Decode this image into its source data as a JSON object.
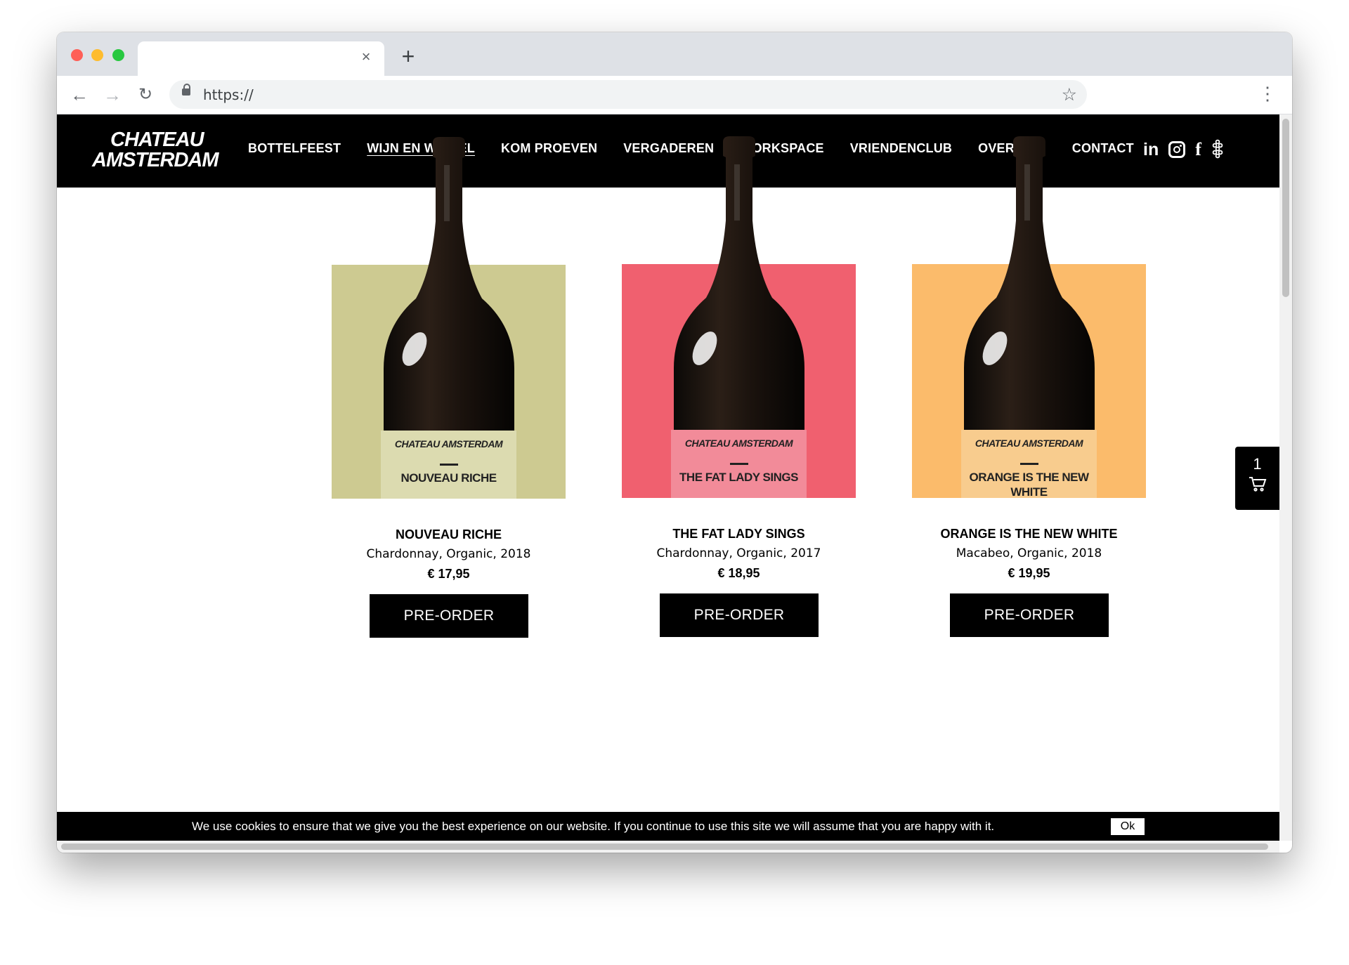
{
  "browser": {
    "url": "https://",
    "tab_close": "×",
    "new_tab": "+"
  },
  "site": {
    "logo": {
      "line1": "CHATEAU",
      "line2": "AMSTERDAM"
    },
    "nav": [
      {
        "label": "BOTTELFEEST",
        "active": false
      },
      {
        "label": "WIJN EN WINKEL",
        "active": true
      },
      {
        "label": "KOM PROEVEN",
        "active": false
      },
      {
        "label": "VERGADEREN",
        "active": false
      },
      {
        "label": "WORKSPACE",
        "active": false
      },
      {
        "label": "VRIENDENCLUB",
        "active": false
      },
      {
        "label": "OVER ONS",
        "active": false
      },
      {
        "label": "CONTACT",
        "active": false
      }
    ],
    "social": [
      "linkedin-icon",
      "instagram-icon",
      "facebook-icon",
      "grapes-icon"
    ]
  },
  "products": [
    {
      "name": "NOUVEAU RICHE",
      "desc": "Chardonnay, Organic, 2018",
      "price": "€ 17,95",
      "button": "PRE-ORDER",
      "bg_color": "#cdca91",
      "label_color": "#dcdbb0",
      "label_brand": "CHATEAU AMSTERDAM",
      "label_name": "NOUVEAU RICHE"
    },
    {
      "name": "THE FAT LADY SINGS",
      "desc": "Chardonnay, Organic, 2017",
      "price": "€ 18,95",
      "button": "PRE-ORDER",
      "bg_color": "#f0606f",
      "label_color": "#f28b99",
      "label_brand": "CHATEAU AMSTERDAM",
      "label_name": "THE FAT LADY SINGS"
    },
    {
      "name": "ORANGE IS THE NEW WHITE",
      "desc": "Macabeo, Organic, 2018",
      "price": "€ 19,95",
      "button": "PRE-ORDER",
      "bg_color": "#fbbb6b",
      "label_color": "#f8cc8e",
      "label_brand": "CHATEAU AMSTERDAM",
      "label_name": "ORANGE IS THE NEW WHITE"
    }
  ],
  "cart": {
    "count": "1",
    "icon": "cart-icon"
  },
  "cookie": {
    "text": "We use cookies to ensure that we give you the best experience on our website. If you continue to use this site we will assume that you are happy with it.",
    "ok": "Ok"
  }
}
